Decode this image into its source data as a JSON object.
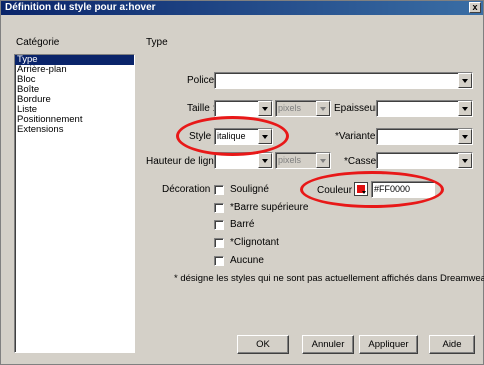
{
  "window": {
    "title": "Définition du style pour a:hover",
    "close_glyph": "x"
  },
  "category_header": "Catégorie",
  "section_header": "Type",
  "categories": [
    {
      "label": "Type",
      "selected": true
    },
    {
      "label": "Arrière-plan",
      "selected": false
    },
    {
      "label": "Bloc",
      "selected": false
    },
    {
      "label": "Boîte",
      "selected": false
    },
    {
      "label": "Bordure",
      "selected": false
    },
    {
      "label": "Liste",
      "selected": false
    },
    {
      "label": "Positionnement",
      "selected": false
    },
    {
      "label": "Extensions",
      "selected": false
    }
  ],
  "form": {
    "police_label": "Police :",
    "police_value": "",
    "taille_label": "Taille :",
    "taille_value": "",
    "taille_unit": "pixels",
    "epaisseur_label": "Epaisseur :",
    "epaisseur_value": "",
    "style_label": "Style :",
    "style_value": "italique",
    "variante_label": "*Variante :",
    "variante_value": "",
    "hauteur_label": "Hauteur de ligne :",
    "hauteur_value": "",
    "hauteur_unit": "pixels",
    "casse_label": "*Casse :",
    "casse_value": "",
    "decoration_label": "Décoration :",
    "decorations": [
      {
        "label": "Souligné",
        "checked": false
      },
      {
        "label": "*Barre supérieure",
        "checked": false
      },
      {
        "label": "Barré",
        "checked": false
      },
      {
        "label": "*Clignotant",
        "checked": false
      },
      {
        "label": "Aucune",
        "checked": false
      }
    ],
    "couleur_label": "Couleur :",
    "couleur_value": "#FF0000",
    "swatch_color": "#e01010",
    "footnote": "* désigne les styles qui ne sont pas actuellement affichés dans Dreamweaver."
  },
  "buttons": {
    "ok": "OK",
    "annuler": "Annuler",
    "appliquer": "Appliquer",
    "aide": "Aide"
  },
  "highlight_color": "#e81818"
}
